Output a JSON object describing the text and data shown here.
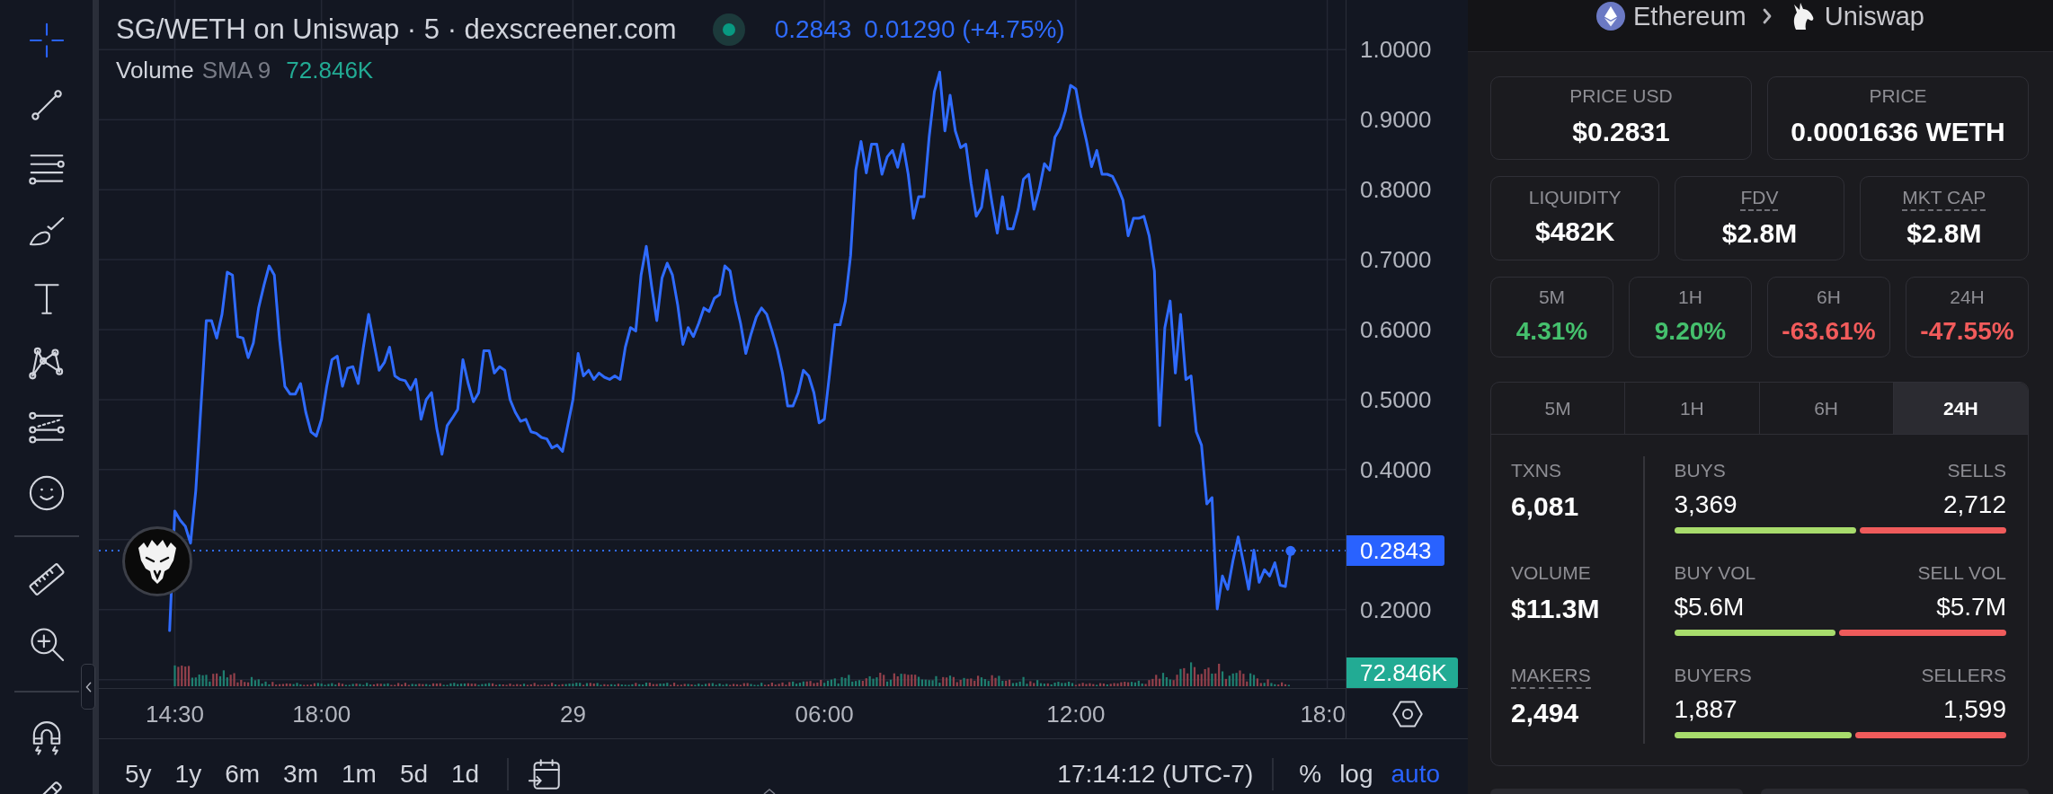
{
  "toolbar": {
    "tool_groups": [
      [
        {
          "kind": "crosshair",
          "selected": true
        },
        {
          "kind": "trend-line",
          "selected": false
        },
        {
          "kind": "parallel-lines",
          "selected": false
        },
        {
          "kind": "brush",
          "selected": false
        },
        {
          "kind": "text",
          "selected": false
        },
        {
          "kind": "pattern",
          "selected": false
        },
        {
          "kind": "fib-lines",
          "selected": false
        },
        {
          "kind": "emoji",
          "selected": false
        }
      ],
      [
        {
          "kind": "ruler",
          "selected": false
        },
        {
          "kind": "zoom-in",
          "selected": false
        }
      ],
      [
        {
          "kind": "magnet",
          "selected": false
        },
        {
          "kind": "pencil",
          "selected": false
        }
      ]
    ]
  },
  "chart": {
    "title": "SG/WETH on Uniswap · 5 · dexscreener.com",
    "legend_price": "0.2843",
    "legend_change": "0.01290 (+4.75%)",
    "volume_legend": {
      "name": "Volume",
      "indicator": "SMA 9",
      "value": "72.846K"
    },
    "volume_tag": "72.846K",
    "chart_data": {
      "type": "line",
      "grid": true,
      "ylim": [
        0.088,
        1.071
      ],
      "yticks": [
        {
          "value": 1,
          "label": "1.0000"
        },
        {
          "value": 0.9,
          "label": "0.9000"
        },
        {
          "value": 0.8,
          "label": "0.8000"
        },
        {
          "value": 0.7,
          "label": "0.7000"
        },
        {
          "value": 0.6,
          "label": "0.6000"
        },
        {
          "value": 0.5,
          "label": "0.5000"
        },
        {
          "value": 0.4,
          "label": "0.4000"
        },
        {
          "value": 0.2,
          "label": "0.2000"
        }
      ],
      "ref_lines": [
        {
          "axis": "y",
          "value": 0.2843,
          "label": "0.2843"
        }
      ],
      "categories": [
        null,
        null,
        null,
        null,
        null,
        null,
        null,
        null,
        null,
        null,
        null,
        null,
        null,
        null,
        "14:30",
        null,
        null,
        null,
        null,
        null,
        null,
        null,
        null,
        null,
        null,
        null,
        null,
        null,
        null,
        null,
        null,
        null,
        null,
        null,
        null,
        null,
        null,
        null,
        null,
        null,
        null,
        null,
        "18:00",
        null,
        null,
        null,
        null,
        null,
        null,
        null,
        null,
        null,
        null,
        null,
        null,
        null,
        null,
        null,
        null,
        null,
        null,
        null,
        null,
        null,
        null,
        null,
        null,
        null,
        null,
        null,
        null,
        null,
        null,
        null,
        null,
        null,
        null,
        null,
        null,
        null,
        null,
        null,
        null,
        null,
        null,
        null,
        null,
        null,
        null,
        null,
        "29",
        null,
        null,
        null,
        null,
        null,
        null,
        null,
        null,
        null,
        null,
        null,
        null,
        null,
        null,
        null,
        null,
        null,
        null,
        null,
        null,
        null,
        null,
        null,
        null,
        null,
        null,
        null,
        null,
        null,
        null,
        null,
        null,
        null,
        null,
        null,
        null,
        null,
        null,
        null,
        null,
        null,
        null,
        null,
        null,
        null,
        null,
        null,
        "06:00",
        null,
        null,
        null,
        null,
        null,
        null,
        null,
        null,
        null,
        null,
        null,
        null,
        null,
        null,
        null,
        null,
        null,
        null,
        null,
        null,
        null,
        null,
        null,
        null,
        null,
        null,
        null,
        null,
        null,
        null,
        null,
        null,
        null,
        null,
        null,
        null,
        null,
        null,
        null,
        null,
        null,
        null,
        null,
        null,
        null,
        null,
        null,
        "12:00",
        null,
        null,
        null,
        null,
        null,
        null,
        null,
        null,
        null,
        null,
        null,
        null,
        null,
        null,
        null,
        null,
        null,
        null,
        null,
        null,
        null,
        null,
        null,
        null,
        null,
        null,
        null,
        null,
        null,
        null,
        null,
        null,
        null,
        null,
        null,
        null,
        null,
        null,
        null,
        null,
        null,
        null,
        null,
        null,
        null,
        null,
        null,
        "18:0",
        null,
        null,
        null
      ],
      "values": [
        null,
        null,
        null,
        null,
        null,
        null,
        null,
        null,
        null,
        null,
        null,
        null,
        null,
        0.17,
        0.341,
        0.328,
        0.319,
        0.295,
        0.37,
        0.491,
        0.613,
        0.613,
        0.588,
        0.622,
        0.682,
        0.678,
        0.59,
        0.588,
        0.56,
        0.581,
        0.631,
        0.663,
        0.691,
        0.678,
        0.585,
        0.519,
        0.508,
        0.508,
        0.523,
        0.482,
        0.454,
        0.448,
        0.472,
        0.519,
        0.557,
        0.562,
        0.519,
        0.545,
        0.547,
        0.523,
        0.575,
        0.622,
        0.581,
        0.542,
        0.553,
        0.575,
        0.534,
        0.529,
        0.527,
        0.514,
        0.529,
        0.472,
        0.5,
        0.51,
        0.459,
        0.422,
        0.463,
        0.474,
        0.486,
        0.557,
        0.523,
        0.497,
        0.51,
        0.57,
        0.57,
        0.538,
        0.547,
        0.542,
        0.5,
        0.482,
        0.469,
        0.472,
        0.454,
        0.452,
        0.446,
        0.444,
        0.431,
        0.435,
        0.426,
        0.463,
        0.5,
        0.566,
        0.534,
        0.542,
        0.529,
        0.538,
        0.532,
        0.529,
        0.534,
        0.529,
        0.575,
        0.603,
        0.598,
        0.678,
        0.719,
        0.663,
        0.613,
        0.674,
        0.695,
        0.678,
        0.635,
        0.579,
        0.603,
        0.59,
        0.609,
        0.631,
        0.626,
        0.645,
        0.65,
        0.691,
        0.684,
        0.641,
        0.609,
        0.566,
        0.594,
        0.618,
        0.631,
        0.622,
        0.598,
        0.572,
        0.538,
        0.491,
        0.491,
        0.51,
        0.542,
        0.534,
        0.51,
        0.467,
        0.472,
        0.538,
        0.607,
        0.607,
        0.641,
        0.706,
        0.828,
        0.869,
        0.824,
        0.865,
        0.865,
        0.822,
        0.847,
        0.856,
        0.832,
        0.865,
        0.822,
        0.759,
        0.79,
        0.79,
        0.875,
        0.94,
        0.968,
        0.884,
        0.935,
        0.884,
        0.86,
        0.865,
        0.809,
        0.762,
        0.775,
        0.828,
        0.781,
        0.738,
        0.79,
        0.744,
        0.744,
        0.772,
        0.815,
        0.822,
        0.772,
        0.8,
        0.837,
        0.828,
        0.875,
        0.888,
        0.912,
        0.949,
        0.944,
        0.903,
        0.871,
        0.833,
        0.856,
        0.822,
        0.822,
        0.819,
        0.804,
        0.785,
        0.734,
        0.759,
        0.759,
        0.762,
        0.734,
        0.684,
        0.463,
        0.603,
        0.641,
        0.538,
        0.622,
        0.529,
        0.534,
        0.454,
        0.435,
        0.351,
        0.36,
        0.201,
        0.248,
        0.229,
        0.27,
        0.304,
        0.267,
        0.229,
        0.285,
        0.239,
        0.257,
        0.248,
        0.267,
        0.235,
        0.233,
        0.284,
        null,
        null,
        null,
        null,
        null,
        null,
        null,
        null,
        null,
        null
      ]
    }
  },
  "bottom_bar": {
    "ranges": [
      {
        "label": "5y",
        "selected": false
      },
      {
        "label": "1y",
        "selected": false
      },
      {
        "label": "6m",
        "selected": false
      },
      {
        "label": "3m",
        "selected": false
      },
      {
        "label": "1m",
        "selected": false
      },
      {
        "label": "5d",
        "selected": false
      },
      {
        "label": "1d",
        "selected": false
      }
    ],
    "time": "17:14:12 (UTC-7)",
    "scale_options": [
      {
        "label": "%",
        "selected": false
      },
      {
        "label": "log",
        "selected": false
      },
      {
        "label": "auto",
        "selected": true
      }
    ]
  },
  "pair_path": {
    "chain": "Ethereum",
    "dex": "Uniswap"
  },
  "price_cards": [
    {
      "label": "PRICE USD",
      "value": "$0.2831"
    },
    {
      "label": "PRICE",
      "value": "0.0001636 WETH"
    }
  ],
  "metric_cards": [
    {
      "label": "LIQUIDITY",
      "value": "$482K",
      "underlined": false
    },
    {
      "label": "FDV",
      "value": "$2.8M",
      "underlined": true
    },
    {
      "label": "MKT CAP",
      "value": "$2.8M",
      "underlined": true
    }
  ],
  "change_cards": [
    {
      "label": "5M",
      "value": "4.31%",
      "color": "#45c06d"
    },
    {
      "label": "1H",
      "value": "9.20%",
      "color": "#45c06d"
    },
    {
      "label": "6H",
      "value": "-63.61%",
      "color": "#f25b5b"
    },
    {
      "label": "24H",
      "value": "-47.55%",
      "color": "#f25b5b"
    }
  ],
  "stats": {
    "tabs": [
      {
        "label": "5M",
        "selected": false
      },
      {
        "label": "1H",
        "selected": false
      },
      {
        "label": "6H",
        "selected": false
      },
      {
        "label": "24H",
        "selected": true
      }
    ],
    "totals": [
      {
        "label": "TXNS",
        "value": "6,081",
        "underlined": false
      },
      {
        "label": "VOLUME",
        "value": "$11.3M",
        "underlined": false
      },
      {
        "label": "MAKERS",
        "value": "2,494",
        "underlined": true
      }
    ],
    "splits": [
      {
        "left_label": "BUYS",
        "left_value": "3,369",
        "right_label": "SELLS",
        "right_value": "2,712",
        "level": 0.554
      },
      {
        "left_label": "BUY VOL",
        "left_value": "$5.6M",
        "right_label": "SELL VOL",
        "right_value": "$5.7M",
        "level": 0.49
      },
      {
        "left_label": "BUYERS",
        "left_value": "1,887",
        "right_label": "SELLERS",
        "right_value": "1,599",
        "level": 0.541
      }
    ]
  }
}
